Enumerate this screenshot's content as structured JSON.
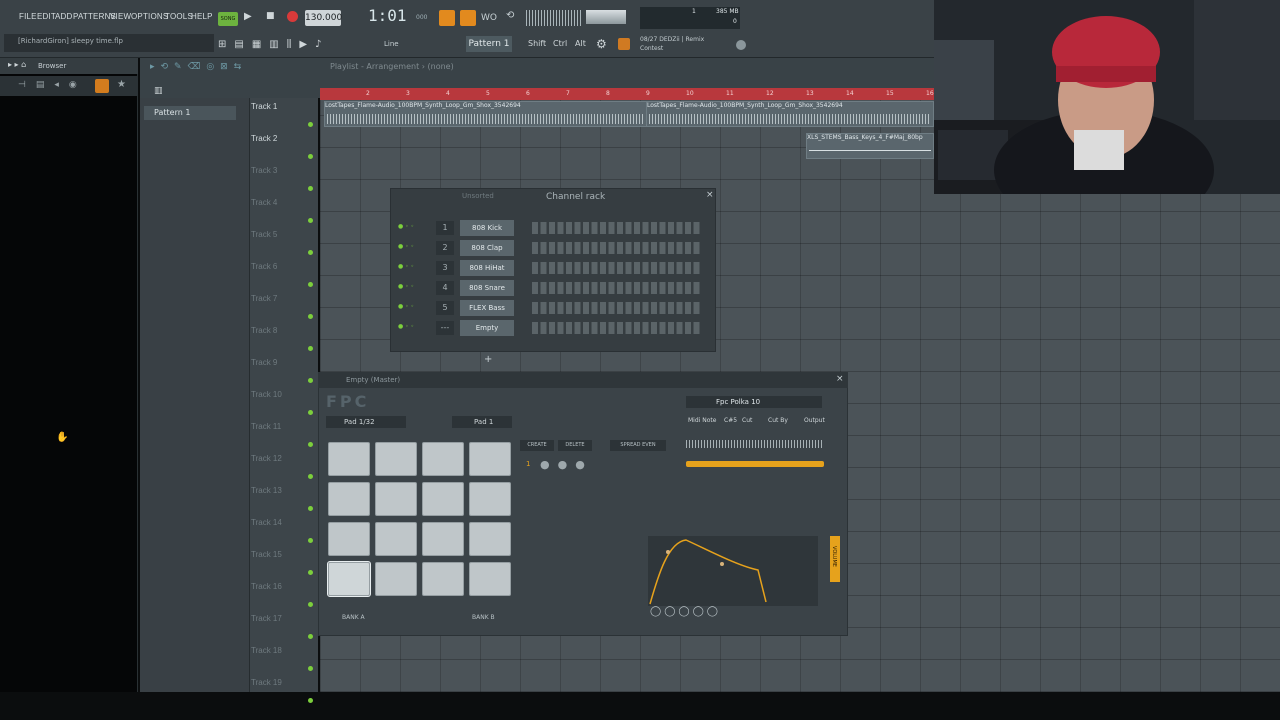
{
  "menu": [
    "FILE",
    "EDIT",
    "ADD",
    "PATTERNS",
    "VIEW",
    "OPTIONS",
    "TOOLS",
    "HELP"
  ],
  "transport": {
    "song_label": "SONG",
    "bpm": "130.000",
    "time": "1:01",
    "time_sub": "000",
    "memory_top": "1",
    "memory_mb": "385 MB",
    "memory_bottom": "0"
  },
  "hint": "[RichardGiron] sleepy time.flp",
  "toolbar": {
    "snap": "Line",
    "pattern": "Pattern 1",
    "shift": "Shift",
    "ctrl": "Ctrl",
    "alt": "Alt",
    "news_line1": "08/27  DEDZii | Remix",
    "news_line2": "Contest"
  },
  "browser": {
    "title": "Browser"
  },
  "picker": {
    "item": "Pattern 1"
  },
  "playlist": {
    "title": "Playlist - Arrangement › (none)"
  },
  "ruler": [
    "2",
    "3",
    "4",
    "5",
    "6",
    "7",
    "8",
    "9",
    "10",
    "11",
    "12",
    "13",
    "14",
    "15",
    "16"
  ],
  "tracks": [
    "Track 1",
    "Track 2",
    "Track 3",
    "Track 4",
    "Track 5",
    "Track 6",
    "Track 7",
    "Track 8",
    "Track 9",
    "Track 10",
    "Track 11",
    "Track 12",
    "Track 13",
    "Track 14",
    "Track 15",
    "Track 16",
    "Track 17",
    "Track 18",
    "Track 19"
  ],
  "clips": {
    "a": "LostTapes_Flame-Audio_100BPM_Synth_Loop_Gm_Shox_3542694",
    "b": "LostTapes_Flame-Audio_100BPM_Synth_Loop_Gm_Shox_3542694",
    "c": "XLS_STEMS_Bass_Keys_4_F#Maj_80bp"
  },
  "rack": {
    "title": "Channel rack",
    "filter": "Unsorted",
    "channels": [
      {
        "num": "1",
        "name": "808 Kick"
      },
      {
        "num": "2",
        "name": "808 Clap"
      },
      {
        "num": "3",
        "name": "808 HiHat"
      },
      {
        "num": "4",
        "name": "808 Snare"
      },
      {
        "num": "5",
        "name": "FLEX Bass"
      },
      {
        "num": "---",
        "name": "Empty"
      }
    ]
  },
  "fpc": {
    "title": "Empty (Master)",
    "logo": "FPC",
    "pad_bank": "Pad 1/32",
    "pad": "Pad 1",
    "preset": "Fpc Polka 10",
    "create": "CREATE",
    "delete": "DELETE",
    "spread": "SPREAD EVEN",
    "midi_note": "Midi Note",
    "note_val": "C#5",
    "cut": "Cut",
    "cut_by": "Cut By",
    "output": "Output",
    "bank_a": "BANK A",
    "bank_b": "BANK B",
    "volume": "VOLUME",
    "layer": "1"
  }
}
